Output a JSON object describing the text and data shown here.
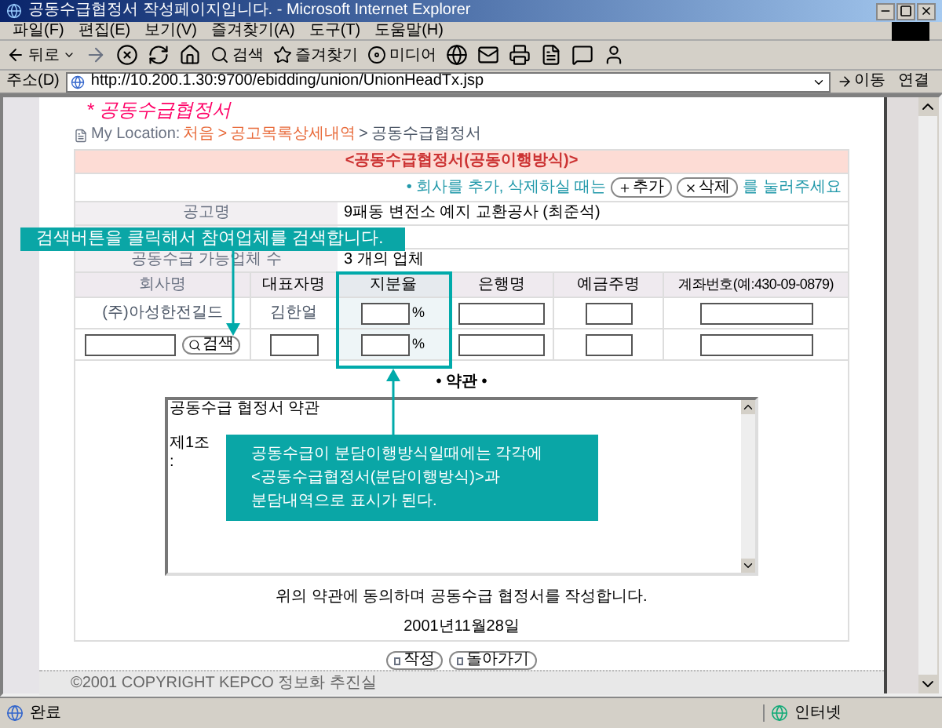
{
  "window": {
    "title": "공동수급협정서 작성페이지입니다. - Microsoft Internet Explorer"
  },
  "menu": [
    "파일(F)",
    "편집(E)",
    "보기(V)",
    "즐겨찾기(A)",
    "도구(T)",
    "도움말(H)"
  ],
  "toolbar": {
    "back": "뒤로",
    "search": "검색",
    "favorites": "즐겨찾기",
    "media": "미디어"
  },
  "address": {
    "label": "주소(D)",
    "url": "http://10.200.1.30:9700/ebidding/union/UnionHeadTx.jsp",
    "go": "이동",
    "links": "연결"
  },
  "page": {
    "logo": "* 공동수급협정서",
    "breadcrumb": {
      "label": "My Location:",
      "links": [
        "처음",
        "공고목록상세내역"
      ],
      "current": "공동수급협정서",
      "separator": ">"
    },
    "heading": "<공동수급협정서(공동이행방식)>",
    "notice": {
      "before": "• 회사를 추가, 삭제하실 때는",
      "add": "추가",
      "delete": "삭제",
      "after": "를 눌러주세요"
    },
    "info_rows": [
      {
        "label": "공고명",
        "value": "9패동 변전소 예지 교환공사 (최준석)"
      },
      {
        "label": "공동수급 가능업체 수",
        "value": "3 개의 업체"
      }
    ],
    "columns": [
      "회사명",
      "대표자명",
      "지분율",
      "은행명",
      "예금주명",
      "계좌번호(예:430-09-0879)"
    ],
    "rows": [
      {
        "kind": "filled",
        "company": "(주)아성한전길드",
        "representative": "김한얼",
        "unit": "%"
      },
      {
        "kind": "search",
        "search": "검색",
        "unit": "%"
      }
    ],
    "terms_heading": "• 약관 •",
    "terms": [
      "공동수급 협정서 약관",
      "제1조",
      ":"
    ],
    "agreement": "위의 약관에 동의하며 공동수급 협정서를 작성합니다.",
    "date": "2001년11월28일",
    "buttons": [
      "작성",
      "돌아가기"
    ],
    "footer": "©2001 COPYRIGHT KEPCO 정보화 추진실"
  },
  "callouts": [
    "검색버튼을 클릭해서 참여업체를 검색합니다.",
    "공동수급이 분담이행방식일때에는 각각에\n<공동수급협정서(분담이행방식)>과\n분담내역으로 표시가 된다."
  ],
  "status_bar": {
    "text": "완료",
    "zone": "인터넷"
  }
}
